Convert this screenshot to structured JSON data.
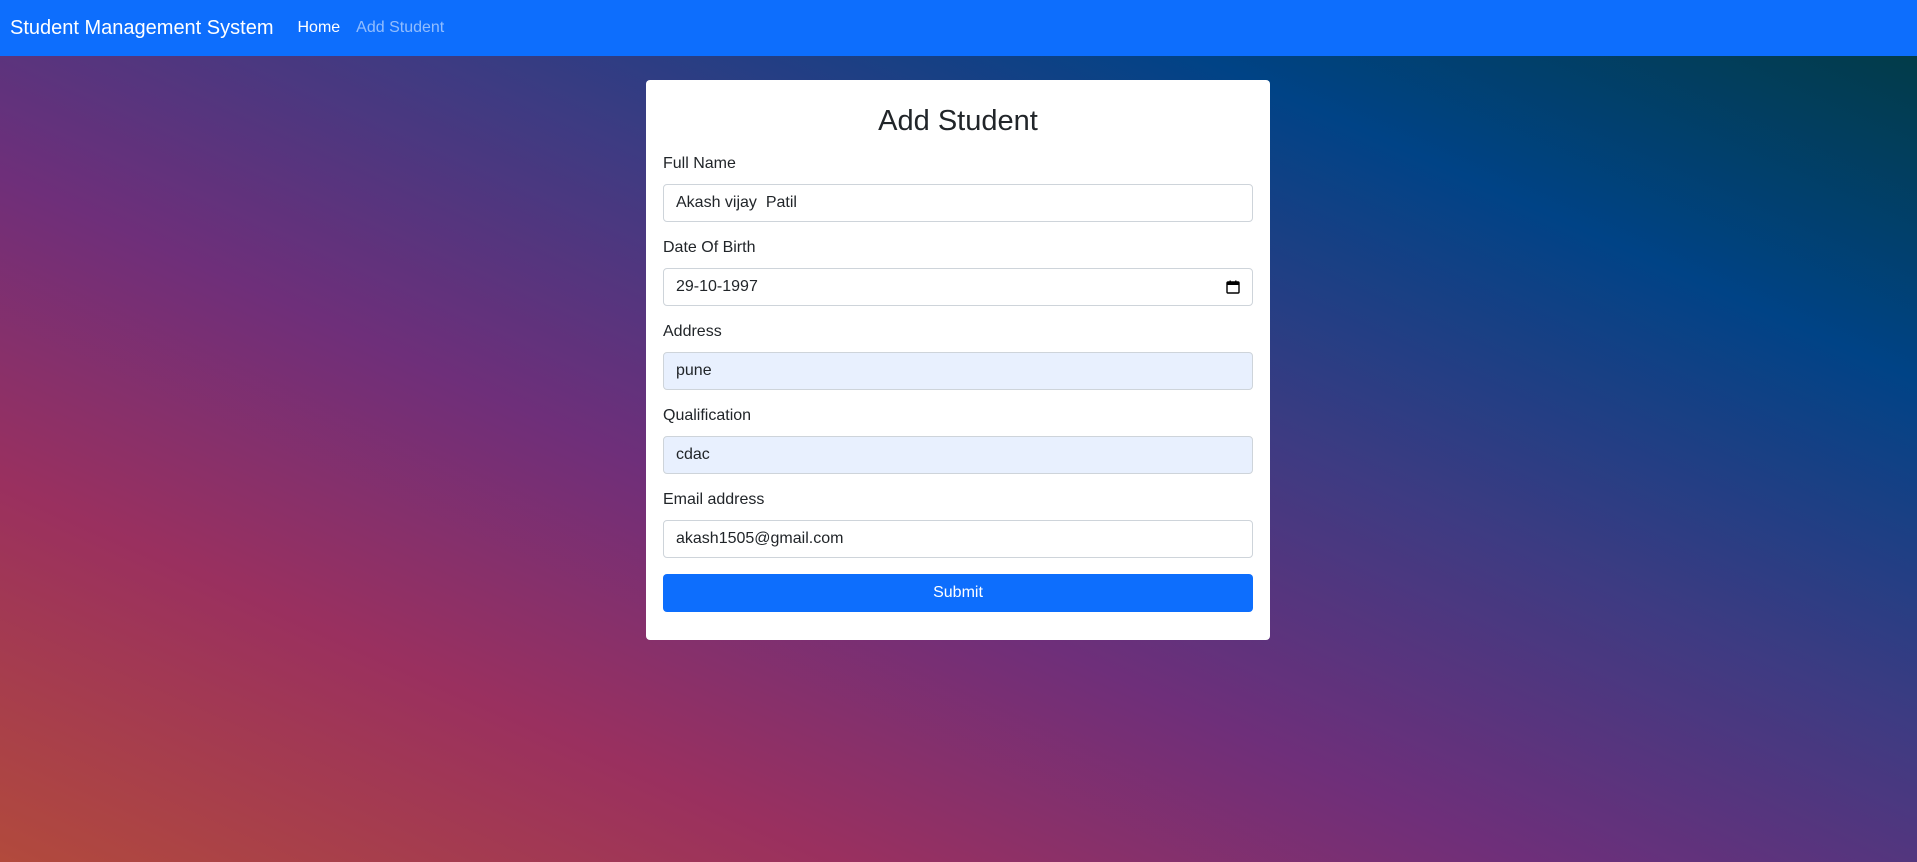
{
  "navbar": {
    "brand": "Student Management System",
    "links": [
      {
        "label": "Home",
        "active": true
      },
      {
        "label": "Add Student",
        "active": false
      }
    ],
    "background": "#0d6efd"
  },
  "form": {
    "title": "Add Student",
    "fields": [
      {
        "label": "Full Name",
        "value": "Akash vijay  Patil",
        "autofilled": false
      },
      {
        "label": "Date Of Birth",
        "value": "29-10-1997",
        "autofilled": false,
        "icon": "calendar-icon"
      },
      {
        "label": "Address",
        "value": "pune",
        "autofilled": true
      },
      {
        "label": "Qualification",
        "value": "cdac",
        "autofilled": true
      },
      {
        "label": "Email address",
        "value": "akash1505@gmail.com",
        "autofilled": false
      }
    ],
    "submit_label": "Submit",
    "accent": "#0d6efd",
    "autofill_color": "#e8f0fe"
  }
}
